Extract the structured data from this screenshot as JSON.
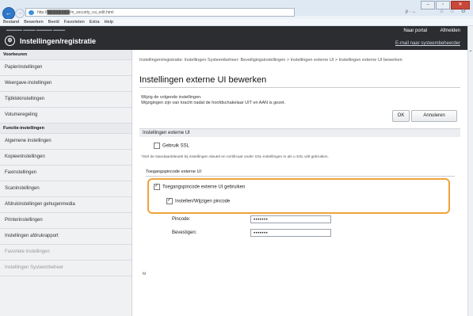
{
  "browser": {
    "url": "http://████████/m_security_rui_edit.html",
    "address_tools": "ρ ∙ ←",
    "toolbar_icons": "⌂ ☆ ⚙",
    "menu": [
      "Bestand",
      "Bewerken",
      "Beeld",
      "Favorieten",
      "Extra",
      "Help"
    ]
  },
  "header": {
    "app_title": "Instellingen/registratie",
    "portal": "Naar portal",
    "logout": "Afmelden",
    "sysadmin_mode": "E-mail naar systeembeheerder"
  },
  "sidebar": {
    "section1": "Voorkeuren",
    "prefs": [
      "Papierinstellingen",
      "Weergave-instellingen",
      "Tijdklokinstellingen",
      "Volumeregeling"
    ],
    "section2": "Functie-instellingen",
    "funcs": [
      "Algemene instellingen",
      "Kopieerinstellingen",
      "Faxinstellingen",
      "Scaninstellingen",
      "Afdrukinstellingen gehugenmedia",
      "Printerinstellingen",
      "Instellingen afdrukrapport",
      "Favoriete instellingen",
      "Instellingen Systeembeheer"
    ]
  },
  "main": {
    "breadcrumb": "Instellingen/registratie: Instellingen Systeembeheer: Beveiligingsinstellingen > Instellingen externe UI > Instellingen externe UI bewerken",
    "title": "Instellingen externe UI bewerken",
    "intro1": "Wijzig de volgende instellingen.",
    "intro2": "Wijzigingen zijn van kracht nadat de hoofdschakelaar UIT en AAN is gezet.",
    "ok": "OK",
    "cancel": "Annuleren",
    "section": "Instellingen externe UI",
    "ssl_label": "Gebruik SSL",
    "ssl_note": "*Stel de standaardsleutel bij instellingen sleutel en certificaat onder SSL-instellingen in als u SSL wilt gebruiken.",
    "pin_section": "Toegangspincode externe UI",
    "use_pin": "Toegangspincode externe UI gebruiken",
    "set_pin": "Instellen/Wijzigen pincode",
    "pin_label": "Pincode:",
    "pin_value": "•••••••",
    "confirm_label": "Bevestigen:",
    "confirm_value": "•••••••",
    "to_top": "ᵚ"
  },
  "colors": {
    "highlight": "#f0a23a",
    "header": "#2b2d31",
    "back_button": "#2f78c9"
  }
}
